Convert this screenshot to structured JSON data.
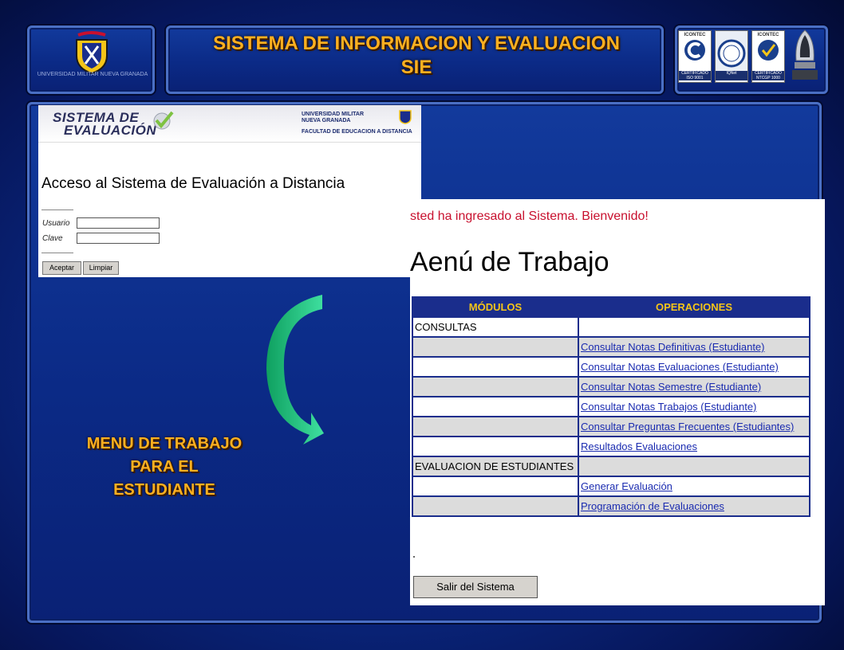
{
  "header": {
    "title_line1": "SISTEMA DE INFORMACION  Y  EVALUACION",
    "title_line2": "SIE",
    "logo_caption": "UNIVERSIDAD MILITAR NUEVA GRANADA"
  },
  "certifications": [
    {
      "header": "ICONTEC",
      "footer": "CERTIFICADO ISO 9001"
    },
    {
      "header": "",
      "footer": "IQNet"
    },
    {
      "header": "ICONTEC",
      "footer": "CERTIFICADO NTCGP 1000"
    }
  ],
  "login": {
    "logo_line1": "SISTEMA DE",
    "logo_line2": "EVALUACIÓN",
    "university_line1": "UNIVERSIDAD MILITAR",
    "university_line2": "NUEVA GRANADA",
    "faculty": "FACULTAD DE EDUCACION A DISTANCIA",
    "heading": "Acceso al Sistema de Evaluación a Distancia",
    "user_label": "Usuario",
    "password_label": "Clave",
    "accept_button": "Aceptar",
    "clear_button": "Limpiar"
  },
  "menu": {
    "welcome": "sted ha ingresado al Sistema. Bienvenido!",
    "title": "Aenú de Trabajo",
    "col_modules": "MÓDULOS",
    "col_operations": "OPERACIONES",
    "rows": [
      {
        "module": "CONSULTAS",
        "operation": ""
      },
      {
        "module": "",
        "operation": "Consultar Notas Definitivas (Estudiante)"
      },
      {
        "module": "",
        "operation": "Consultar Notas Evaluaciones (Estudiante)"
      },
      {
        "module": "",
        "operation": "Consultar Notas Semestre (Estudiante)"
      },
      {
        "module": "",
        "operation": "Consultar Notas Trabajos (Estudiante)"
      },
      {
        "module": "",
        "operation": "Consultar Preguntas Frecuentes (Estudiantes)"
      },
      {
        "module": "",
        "operation": "Resultados Evaluaciones"
      },
      {
        "module": "EVALUACION DE ESTUDIANTES",
        "operation": ""
      },
      {
        "module": "",
        "operation": "Generar Evaluación"
      },
      {
        "module": "",
        "operation": "Programación de Evaluaciones"
      }
    ],
    "exit_button": "Salir del Sistema"
  },
  "caption": {
    "line1": "MENU  DE TRABAJO",
    "line2": "PARA EL",
    "line3": "ESTUDIANTE"
  },
  "colors": {
    "title_gold": "#ffb020",
    "table_navy": "#1a2d8c",
    "table_header_text": "#f5c518",
    "link_blue": "#1a2bb0",
    "welcome_red": "#c8102e",
    "arrow_green": "#1fbf7a"
  }
}
